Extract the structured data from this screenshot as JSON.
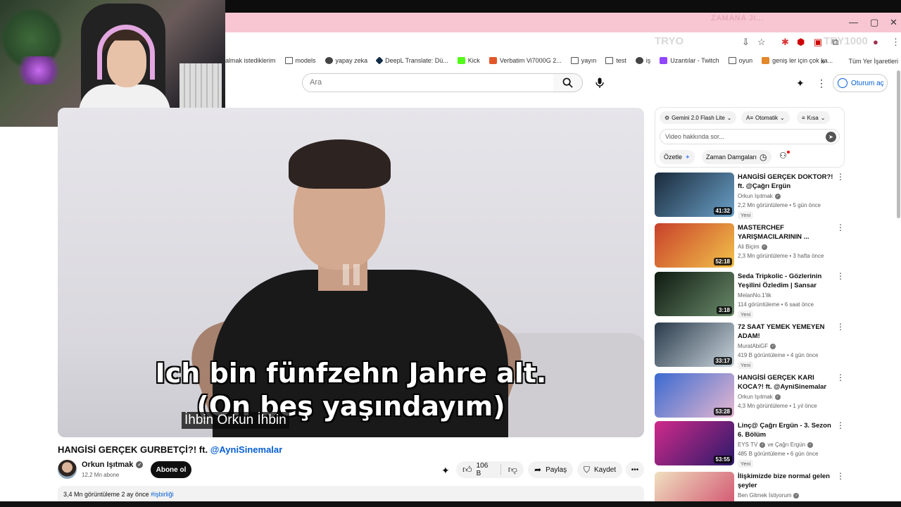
{
  "browser": {
    "faint_header": "ZAMANA JI...",
    "ghost_left": "TRYO",
    "ghost_right": "TRY1000",
    "bookmarks": [
      {
        "label": "almak istediklerim",
        "icon": "none",
        "color": ""
      },
      {
        "label": "models",
        "icon": "folder-icon",
        "color": ""
      },
      {
        "label": "yapay zeka",
        "icon": "globe-icon",
        "color": "#444444"
      },
      {
        "label": "DeepL Translate: Dü...",
        "icon": "deepl-icon",
        "color": "#0f2b46"
      },
      {
        "label": "Kick",
        "icon": "kick-icon",
        "color": "#53fc18"
      },
      {
        "label": "Verbatim Vi7000G 2...",
        "icon": "store-icon",
        "color": "#e2572a"
      },
      {
        "label": "yayın",
        "icon": "folder-icon",
        "color": ""
      },
      {
        "label": "test",
        "icon": "folder-icon",
        "color": ""
      },
      {
        "label": "iş",
        "icon": "globe-icon",
        "color": "#444444"
      },
      {
        "label": "Uzantılar - Twitch",
        "icon": "twitch-icon",
        "color": "#9146ff"
      },
      {
        "label": "oyun",
        "icon": "folder-icon",
        "color": ""
      },
      {
        "label": "geniş ler için çok ka...",
        "icon": "store-icon",
        "color": "#e2872a"
      }
    ],
    "more_bookmarks": "»",
    "all_bookmarks": "Tüm Yer İşaretleri"
  },
  "youtube": {
    "search_placeholder": "Ara",
    "signin_label": "Oturum aç"
  },
  "video": {
    "subtitle_line1": "Ich bin fünfzehn Jahre alt.",
    "subtitle_line2": "(On beş yaşındayım)",
    "caption": "İhbin Orkun İhbin",
    "title": "HANGİSİ GERÇEK GURBETÇİ?! ft.",
    "title_mention": "@AyniSinemalar",
    "channel": "Orkun Işıtmak",
    "subscribers": "12,2 Mn abone",
    "subscribe_label": "Abone ol",
    "likes": "106 B",
    "share_label": "Paylaş",
    "save_label": "Kaydet",
    "views_line": "3,4 Mn görüntüleme  2 ay önce",
    "hashtag": "#işbirliği"
  },
  "ai_panel": {
    "model": "Gemini 2.0 Flash Lite",
    "language": "Otomatik",
    "length": "Kısa",
    "ask_placeholder": "Video hakkında sor...",
    "summarize_label": "Özetle",
    "timestamps_label": "Zaman Damgaları"
  },
  "recommendations": [
    {
      "title": "HANGİSİ GERÇEK DOKTOR?! ft. @Çağrı Ergün",
      "channel": "Orkun Işıtmak",
      "verified": true,
      "meta": "2,2 Mn görüntüleme • 5 gün önce",
      "badge": "Yeni",
      "duration": "41:32",
      "colors": [
        "#1a2a3a",
        "#6aa0c8"
      ]
    },
    {
      "title": "MASTERCHEF YARIŞMACILARININ ...",
      "channel": "Ali Biçim",
      "verified": true,
      "meta": "2,3 Mn görüntüleme • 3 hafta önce",
      "badge": "",
      "duration": "52:18",
      "colors": [
        "#c8402a",
        "#f2c24a"
      ]
    },
    {
      "title": "Seda Tripkolic - Gözlerinin Yeşilini Özledim | Sansar Salvo...",
      "channel": "MelanNo.1'lik",
      "verified": false,
      "meta": "114 görüntüleme • 6 saat önce",
      "badge": "Yeni",
      "duration": "3:18",
      "colors": [
        "#0e1a10",
        "#6a8a6a"
      ]
    },
    {
      "title": "72 SAAT YEMEK YEMEYEN ADAM!",
      "channel": "MuratAbiGF",
      "verified": true,
      "meta": "419 B görüntüleme • 4 gün önce",
      "badge": "Yeni",
      "duration": "33:17",
      "colors": [
        "#2a3a4a",
        "#c8d4dc"
      ]
    },
    {
      "title": "HANGİSİ GERÇEK KARI KOCA?! ft. @AyniSinemalar",
      "channel": "Orkun Işıtmak",
      "verified": true,
      "meta": "4,3 Mn görüntüleme • 1 yıl önce",
      "badge": "",
      "duration": "53:28",
      "colors": [
        "#3a6ad0",
        "#e8b8d0"
      ]
    },
    {
      "title": "Linç@ Çağrı Ergün - 3. Sezon 6. Bölüm",
      "channel": "EYS TV",
      "channel2": "ve Çağrı Ergün",
      "verified": true,
      "meta": "485 B görüntüleme • 6 gün önce",
      "badge": "Yeni",
      "duration": "53:55",
      "colors": [
        "#d02a8a",
        "#2a1a6a"
      ]
    },
    {
      "title": "İlişkimizde bize normal gelen şeyler",
      "channel": "Ben Gitmek İstiyorum",
      "verified": true,
      "meta": "",
      "badge": "",
      "duration": "",
      "colors": [
        "#f0e0c0",
        "#d04a6a"
      ]
    }
  ]
}
